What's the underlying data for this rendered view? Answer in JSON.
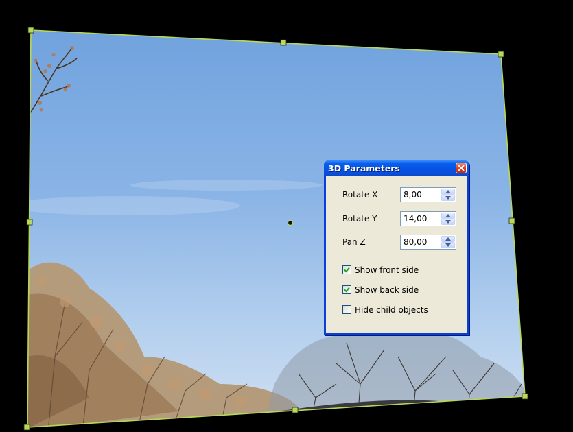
{
  "canvas": {
    "background": "#000000",
    "frame_color": "#b8d85a"
  },
  "dialog": {
    "title": "3D Parameters",
    "close_icon": "close-icon",
    "fields": [
      {
        "label": "Rotate X",
        "value": "8,00"
      },
      {
        "label": "Rotate Y",
        "value": "14,00"
      },
      {
        "label": "Pan Z",
        "value": "80,00"
      }
    ],
    "checkboxes": [
      {
        "label": "Show front side",
        "checked": true
      },
      {
        "label": "Show back side",
        "checked": true
      },
      {
        "label": "Hide child objects",
        "checked": false
      }
    ],
    "colors": {
      "title_blue": "#0a5fec",
      "close_red": "#d7361d",
      "body": "#ece9d8",
      "check_green": "#21a121"
    }
  }
}
